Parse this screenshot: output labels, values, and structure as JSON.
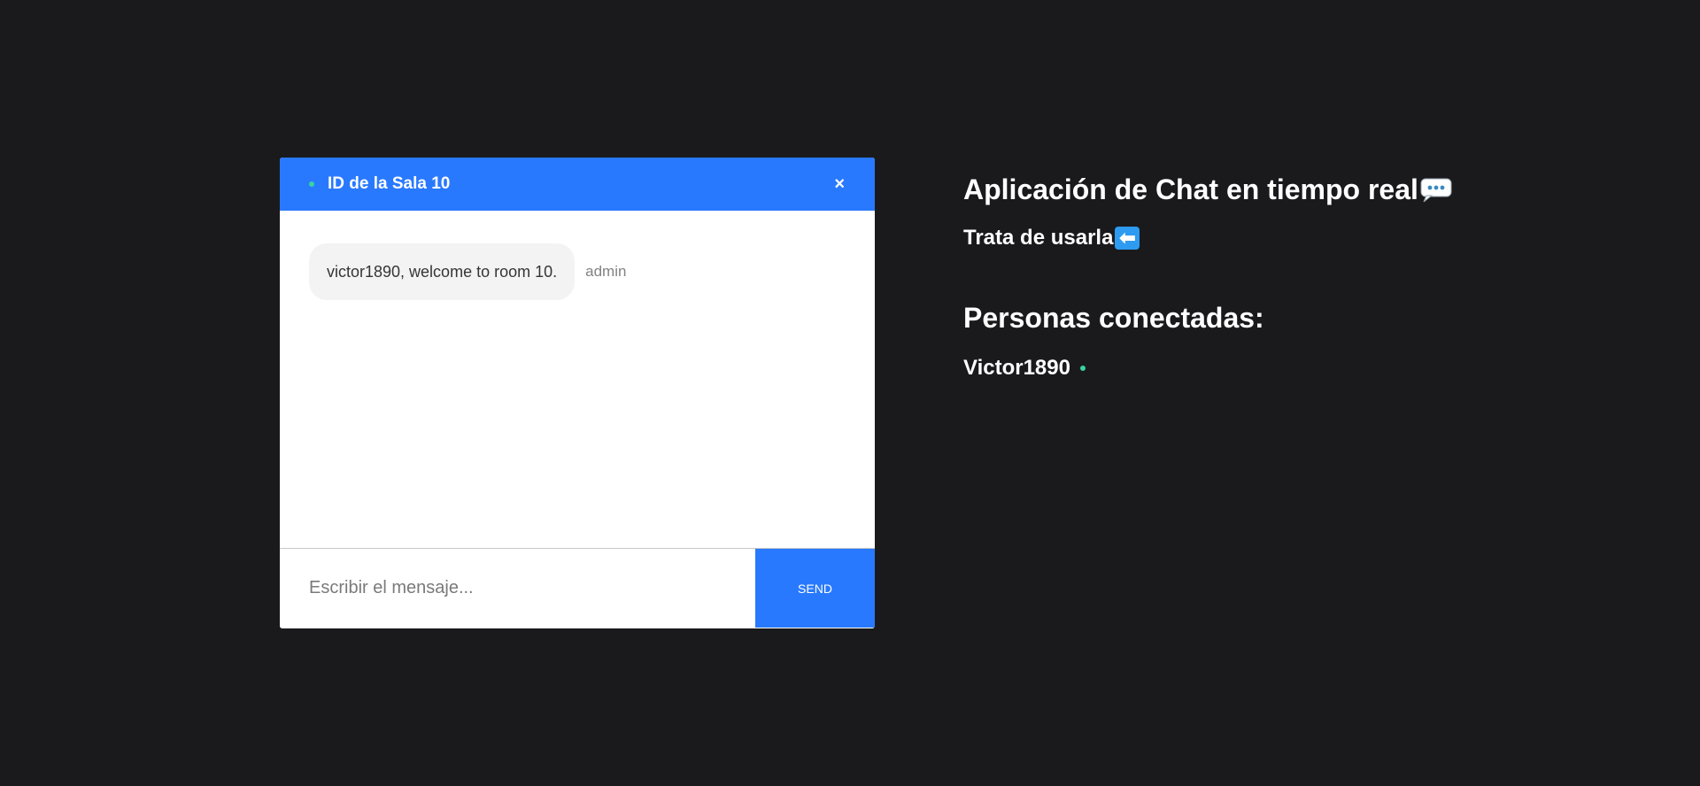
{
  "colors": {
    "background": "#1a1a1d",
    "accent": "#2979ff",
    "online": "#38d39f"
  },
  "chat": {
    "room_title": "ID de la Sala 10",
    "close_label": "×",
    "messages": [
      {
        "text": "victor1890, welcome to room 10.",
        "sender": "admin"
      }
    ],
    "input_placeholder": "Escribir el mensaje...",
    "input_value": "",
    "send_label": "Send"
  },
  "info": {
    "title": "Aplicación de Chat en tiempo real",
    "title_icon": "speech-balloon-icon",
    "subtitle": "Trata de usarla",
    "subtitle_icon": "left-arrow-icon",
    "connected_heading": "Personas conectadas:",
    "users": [
      "Victor1890"
    ]
  }
}
